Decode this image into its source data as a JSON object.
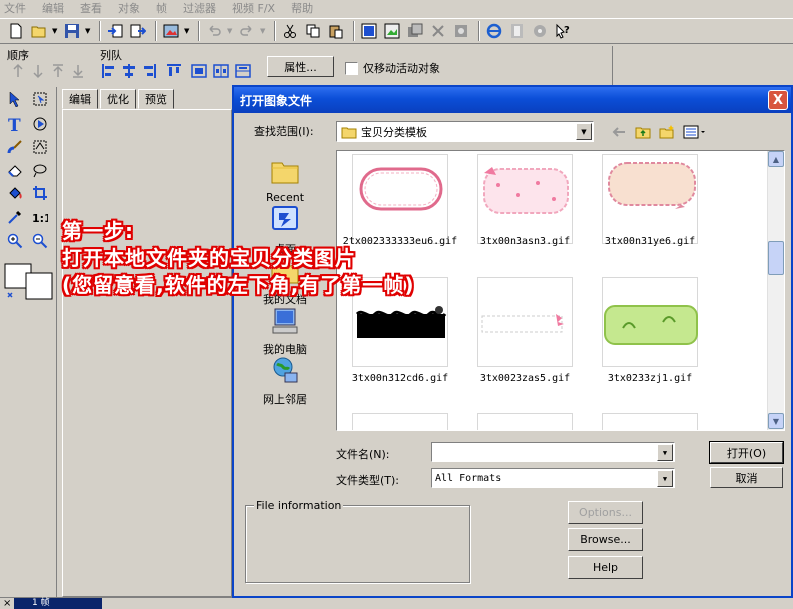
{
  "menubar": [
    "文件",
    "编辑",
    "查看",
    "对象",
    "帧",
    "过滤器",
    "视频 F/X",
    "帮助"
  ],
  "orderbar": {
    "order_label": "顺序",
    "queue_label": "列队",
    "properties_button": "属性...",
    "move_active_only": "仅移动活动对象"
  },
  "panel": {
    "tabs": [
      "编辑",
      "优化",
      "预览"
    ]
  },
  "frame_tab": {
    "close": "×",
    "label": "1 帧"
  },
  "dialog": {
    "title": "打开图象文件",
    "close": "X",
    "look_in_label": "查找范围(I):",
    "look_in_value": "宝贝分类模板",
    "places": [
      {
        "label": "Recent",
        "icon": "recent-folder-icon"
      },
      {
        "label": "桌面",
        "icon": "desktop-icon"
      },
      {
        "label": "我的文档",
        "icon": "my-documents-icon"
      },
      {
        "label": "我的电脑",
        "icon": "my-computer-icon"
      },
      {
        "label": "网上邻居",
        "icon": "network-icon"
      }
    ],
    "files": [
      {
        "name": "2tx002333333eu6.gif",
        "style": "pink-dotted-frame"
      },
      {
        "name": "3tx00n3asn3.gif",
        "style": "pink-polka-lace"
      },
      {
        "name": "3tx00n31ye6.gif",
        "style": "beige-dashed-bow"
      },
      {
        "name": "3tx00n312cd6.gif",
        "style": "black-lace"
      },
      {
        "name": "3tx0023zas5.gif",
        "style": "white-dashed-bow"
      },
      {
        "name": "3tx0233zj1.gif",
        "style": "green-leaves"
      },
      {
        "name": "",
        "style": "blank"
      },
      {
        "name": "",
        "style": "blank"
      },
      {
        "name": "",
        "style": "blank"
      }
    ],
    "filename_label": "文件名(N):",
    "filename_value": "",
    "filetype_label": "文件类型(T):",
    "filetype_value": "All Formats",
    "open_button": "打开(O)",
    "cancel_button": "取消",
    "file_info_label": "File information",
    "options_button": "Options...",
    "browse_button": "Browse...",
    "help_button": "Help"
  },
  "annotation": {
    "line1": "第一步:",
    "line2": "打开本地文件夹的宝贝分类图片",
    "line3": "(您留意看,软件的左下角,有了第一帧)"
  },
  "colors": {
    "title_bar": "#0b4ed7",
    "dialog_border": "#0a44c8",
    "close_button": "#d8553e",
    "annotation_text": "#ffffff",
    "annotation_outline": "#e00000",
    "window_bg": "#d4d0c8"
  }
}
